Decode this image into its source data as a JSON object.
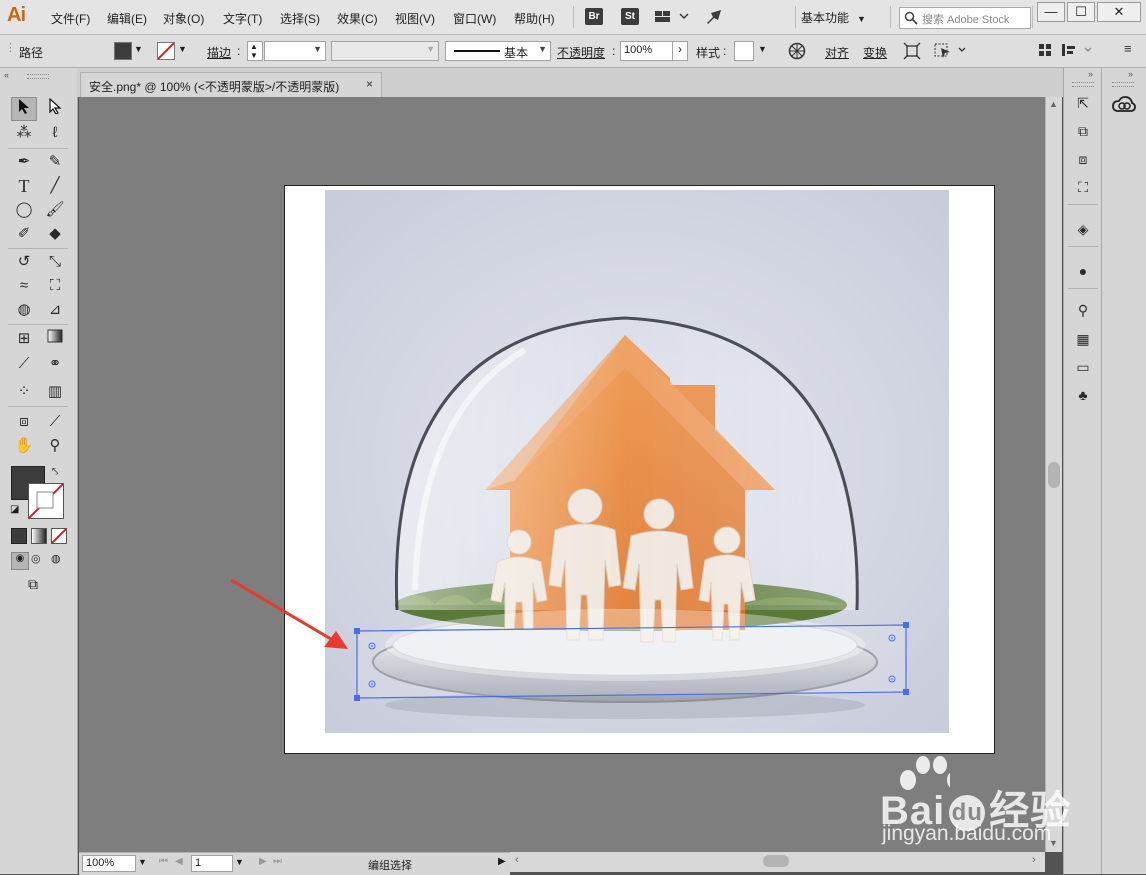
{
  "app": {
    "logo": "Ai",
    "workspace": "基本功能",
    "search_placeholder": "搜索 Adobe Stock"
  },
  "menu": [
    "文件(F)",
    "编辑(E)",
    "对象(O)",
    "文字(T)",
    "选择(S)",
    "效果(C)",
    "视图(V)",
    "窗口(W)",
    "帮助(H)"
  ],
  "menu_icons": {
    "bridge": "Br",
    "stock": "St"
  },
  "window_controls": {
    "minimize": "—",
    "maximize": "☐",
    "close": "✕"
  },
  "control_bar": {
    "selection_type": "路径",
    "stroke_label": "描边",
    "stroke_profile": "基本",
    "opacity_label": "不透明度",
    "opacity_value": "100%",
    "style_label": "样式",
    "align_label": "对齐",
    "transform_label": "变换",
    "fill_color": "#3c3c3c"
  },
  "document": {
    "tab_title": "安全.png* @ 100% (<不透明蒙版>/不透明蒙版)",
    "close": "×"
  },
  "status_bar": {
    "zoom": "100%",
    "artboard": "1",
    "status_text": "编组选择"
  },
  "colors": {
    "accent_selection": "#4a6fe3",
    "arrow_red": "#e83a2f",
    "house_orange": "#e8873a"
  },
  "watermark": {
    "brand": "Bai",
    "brand_cn": "经验",
    "brand_du": "du",
    "url": "jingyan.baidu.com"
  }
}
